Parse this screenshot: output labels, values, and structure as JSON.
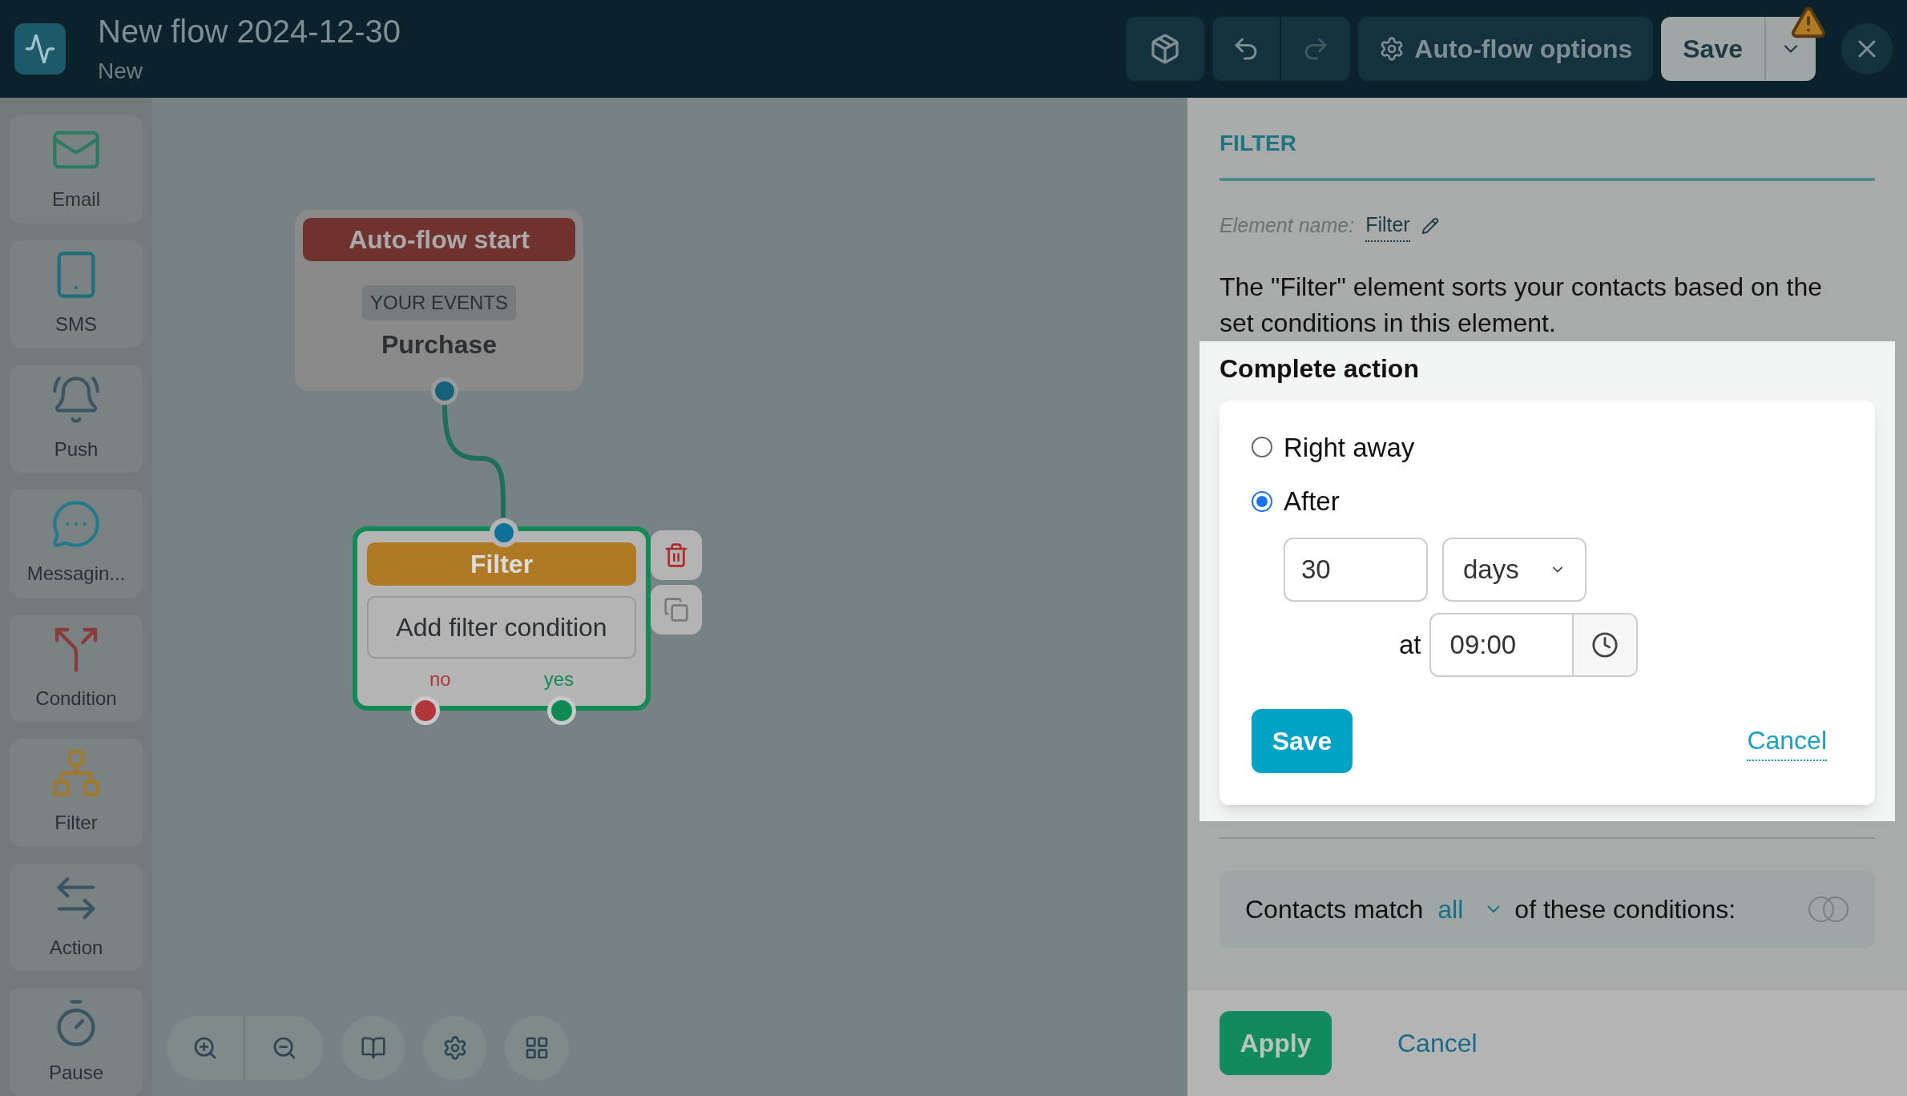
{
  "header": {
    "title": "New flow 2024-12-30",
    "subtitle": "New",
    "options_button": "Auto-flow options",
    "save_button": "Save",
    "redo_disabled": true
  },
  "palette": [
    {
      "label": "Email",
      "kind": "email"
    },
    {
      "label": "SMS",
      "kind": "sms"
    },
    {
      "label": "Push",
      "kind": "push"
    },
    {
      "label": "Messagin...",
      "kind": "messaging"
    },
    {
      "label": "Condition",
      "kind": "condition"
    },
    {
      "label": "Filter",
      "kind": "filter"
    },
    {
      "label": "Action",
      "kind": "action"
    },
    {
      "label": "Pause",
      "kind": "pause"
    }
  ],
  "canvas": {
    "start_node": {
      "title": "Auto-flow start",
      "tag": "YOUR EVENTS",
      "event": "Purchase"
    },
    "filter_node": {
      "title": "Filter",
      "action": "Add filter condition",
      "selected": true,
      "outputs": [
        {
          "label": "no",
          "color": "#b0363a"
        },
        {
          "label": "yes",
          "color": "#0f8a52"
        }
      ]
    }
  },
  "panel": {
    "heading": "FILTER",
    "element_name_label": "Element name:",
    "element_name": "Filter",
    "description": "The \"Filter\" element sorts your contacts based on the set conditions in this element.",
    "complete_action": {
      "title": "Complete action",
      "options": [
        {
          "label": "Right away",
          "selected": false
        },
        {
          "label": "After",
          "selected": true
        }
      ],
      "amount": "30",
      "unit": "days",
      "at_label": "at",
      "time": "09:00",
      "save": "Save",
      "cancel": "Cancel"
    },
    "match": {
      "prefix": "Contacts match",
      "mode": "all",
      "suffix": "of these conditions:"
    },
    "apply": "Apply",
    "cancel": "Cancel"
  }
}
